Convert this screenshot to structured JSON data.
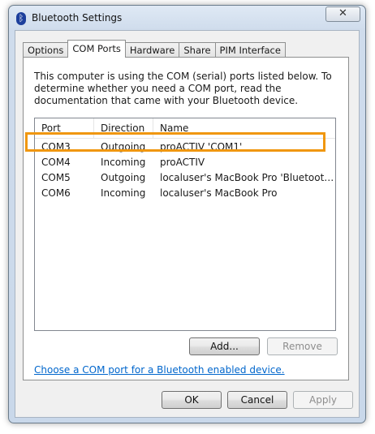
{
  "window": {
    "title": "Bluetooth Settings",
    "close_label": "✕"
  },
  "tabs": [
    {
      "label": "Options",
      "active": false
    },
    {
      "label": "COM Ports",
      "active": true
    },
    {
      "label": "Hardware",
      "active": false
    },
    {
      "label": "Share",
      "active": false
    },
    {
      "label": "PIM Interface",
      "active": false
    }
  ],
  "panel": {
    "description": "This computer is using the COM (serial) ports listed below. To determine whether you need a COM port, read the documentation that came with your Bluetooth device.",
    "columns": [
      "Port",
      "Direction",
      "Name"
    ],
    "rows": [
      {
        "port": "COM3",
        "direction": "Outgoing",
        "name": "proACTIV 'COM1'"
      },
      {
        "port": "COM4",
        "direction": "Incoming",
        "name": "proACTIV"
      },
      {
        "port": "COM5",
        "direction": "Outgoing",
        "name": "localuser's MacBook Pro 'Bluetooth-I..."
      },
      {
        "port": "COM6",
        "direction": "Incoming",
        "name": "localuser's MacBook Pro"
      }
    ],
    "add_label": "Add...",
    "remove_label": "Remove",
    "link_text": "Choose a COM port for a Bluetooth enabled device."
  },
  "footer": {
    "ok_label": "OK",
    "cancel_label": "Cancel",
    "apply_label": "Apply"
  },
  "colors": {
    "highlight": "#f0970f",
    "link": "#0066cc"
  }
}
